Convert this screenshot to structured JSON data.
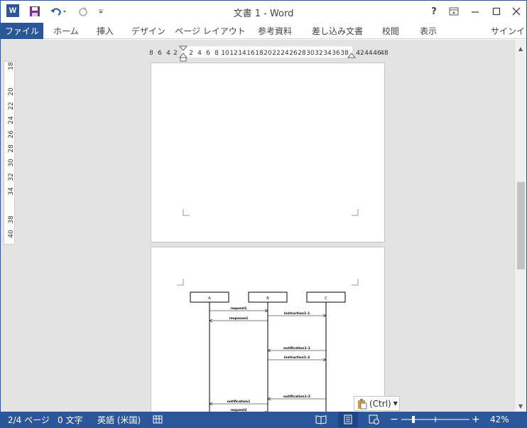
{
  "window": {
    "title": "文書 1 - Word",
    "help": "?",
    "word_logo": "W"
  },
  "ribbon": {
    "tabs": [
      "ファイル",
      "ホーム",
      "挿入",
      "デザイン",
      "ページ レイアウト",
      "参考資料",
      "差し込み文書",
      "校閲",
      "表示"
    ],
    "signin": "サインイン"
  },
  "ruler": {
    "horizontal_labels": [
      "8",
      "6",
      "4",
      "2",
      "2",
      "4",
      "6",
      "8",
      "10",
      "12",
      "14",
      "16",
      "18",
      "20",
      "22",
      "24",
      "26",
      "28",
      "30",
      "32",
      "34",
      "36",
      "38",
      "42",
      "44",
      "46",
      "48"
    ],
    "vertical_labels": [
      "18",
      "20",
      "22",
      "24",
      "26",
      "28",
      "30",
      "32",
      "34",
      "38",
      "40"
    ]
  },
  "diagram": {
    "lifelines": [
      "A",
      "B",
      "C"
    ],
    "messages": [
      {
        "label": "request1",
        "from": "A",
        "to": "B"
      },
      {
        "label": "instruction1-1",
        "from": "B",
        "to": "C"
      },
      {
        "label": "response1",
        "from": "B",
        "to": "A"
      },
      {
        "label": "notification1-1",
        "from": "C",
        "to": "B"
      },
      {
        "label": "instruction1-2",
        "from": "B",
        "to": "C"
      },
      {
        "label": "notification1-2",
        "from": "C",
        "to": "B"
      },
      {
        "label": "notification1",
        "from": "B",
        "to": "A"
      },
      {
        "label": "request2",
        "from": "A",
        "to": "B"
      }
    ]
  },
  "paste_options": {
    "label": "(Ctrl)"
  },
  "status": {
    "page": "2/4 ページ",
    "words": "0 文字",
    "language": "英語 (米国)",
    "zoom": "42%",
    "zoom_level_percent": 42
  },
  "colors": {
    "accent": "#2b579a"
  }
}
